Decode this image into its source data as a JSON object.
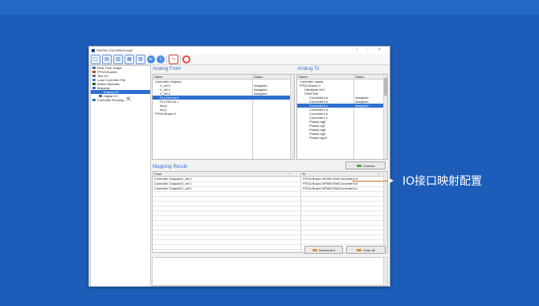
{
  "window": {
    "title": "StarSim IO(Untitled).sngi*",
    "controls": [
      "−",
      "▫",
      "×"
    ]
  },
  "toolbar": {
    "buttons": [
      "new-file",
      "open-file",
      "save-file",
      "save-as",
      "export",
      "play",
      "info",
      "graph",
      "stop"
    ]
  },
  "tree": {
    "items": [
      {
        "label": "Real-Time Target",
        "color": "#3a6fc1",
        "indent": 0
      },
      {
        "label": "FPGA Boards",
        "color": "#b7472a",
        "indent": 0
      },
      {
        "label": "Test I/O",
        "color": "#6a6a6a",
        "indent": 0
      },
      {
        "label": "Load Controller File",
        "color": "#4a7bcf",
        "indent": 0
      },
      {
        "label": "Addon Modules",
        "color": "#2e5f2e",
        "indent": 0
      },
      {
        "label": "Mapping",
        "color": "#3a6fc1",
        "indent": 0
      },
      {
        "label": "Analog I/O",
        "color": "#3a6fc1",
        "indent": 1
      },
      {
        "label": "Digital I/O",
        "color": "#3a6fc1",
        "indent": 1
      },
      {
        "label": "Controller Running",
        "color": "#3a6fc1",
        "indent": 0
      }
    ]
  },
  "analog_from": {
    "title": "Analog From",
    "col_name": "Name",
    "col_status": "Status",
    "rows": [
      {
        "name": "Controller Outputs",
        "status": "",
        "indent": 0
      },
      {
        "name": "V_ref.0",
        "status": "Assigned",
        "indent": 1
      },
      {
        "name": "V_ref.1",
        "status": "Assigned",
        "indent": 1
      },
      {
        "name": "V_ref.2",
        "status": "Assigned",
        "indent": 1
      },
      {
        "name": "PLLSinCos.0",
        "status": "",
        "indent": 1
      },
      {
        "name": "PLLSinCos.1",
        "status": "",
        "indent": 1
      },
      {
        "name": "Idq.0",
        "status": "",
        "indent": 1
      },
      {
        "name": "Idq.1",
        "status": "",
        "indent": 1
      },
      {
        "name": "FPGA Board 0",
        "status": "",
        "indent": 0
      }
    ]
  },
  "analog_to": {
    "title": "Analog To",
    "col_name": "Name",
    "col_status": "Status",
    "rows": [
      {
        "name": "Controller Inputs",
        "status": "",
        "indent": 0
      },
      {
        "name": "FPGA Board 0",
        "status": "",
        "indent": 0
      },
      {
        "name": "Hardware A/O",
        "status": "",
        "indent": 1
      },
      {
        "name": "PWM Ref",
        "status": "",
        "indent": 1
      },
      {
        "name": "Converter0.a",
        "status": "Assigned",
        "indent": 2
      },
      {
        "name": "Converter0.b",
        "status": "Assigned",
        "indent": 2
      },
      {
        "name": "Converter0.c",
        "status": "Assigned",
        "indent": 2
      },
      {
        "name": "Converter1.a",
        "status": "",
        "indent": 2
      },
      {
        "name": "Converter1.b",
        "status": "",
        "indent": 2
      },
      {
        "name": "Converter1.c",
        "status": "",
        "indent": 2
      },
      {
        "name": "PhaseLeg6",
        "status": "",
        "indent": 2
      },
      {
        "name": "PhaseLeg7",
        "status": "",
        "indent": 2
      },
      {
        "name": "PhaseLeg8",
        "status": "",
        "indent": 2
      },
      {
        "name": "PhaseLeg9",
        "status": "",
        "indent": 2
      },
      {
        "name": "PhaseLeg10",
        "status": "",
        "indent": 2
      }
    ]
  },
  "connect": {
    "label": "Connect"
  },
  "mapping": {
    "title": "Mapping Result",
    "col_from": "From",
    "col_to": "To",
    "rows": [
      {
        "from": "Controller Outputs\\V_ref.0",
        "to": "FPGA Board 0\\PWM Ref\\Converter0.a"
      },
      {
        "from": "Controller Outputs\\V_ref.1",
        "to": "FPGA Board 0\\PWM Ref\\Converter0.b"
      },
      {
        "from": "Controller Outputs\\V_ref.2",
        "to": "FPGA Board 0\\PWM Ref\\Converter0.c"
      }
    ]
  },
  "buttons": {
    "disconnect": "Disconnect",
    "clear_all": "Clear All"
  },
  "annotation": {
    "text": "IO接口映射配置"
  },
  "colors": {
    "background": "#1d5db9",
    "selection": "#2f6fd1",
    "accent_title": "#3f74c9"
  }
}
